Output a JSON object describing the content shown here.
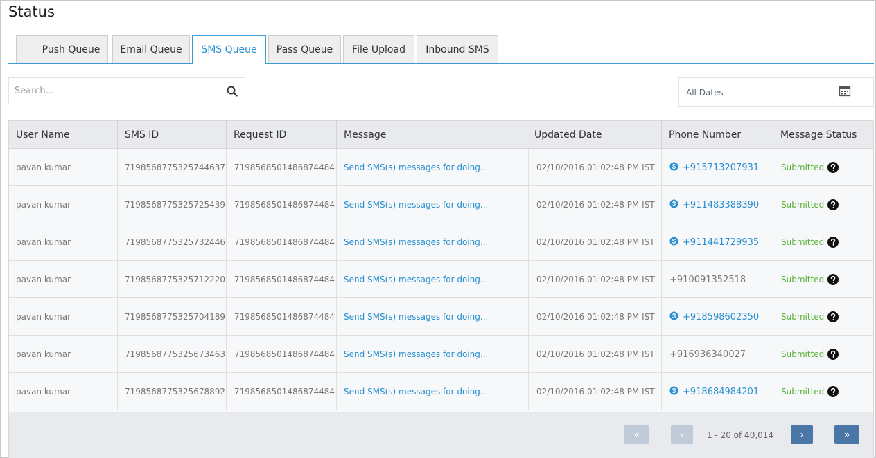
{
  "page": {
    "title": "Status"
  },
  "tabs": [
    {
      "label": "Push Queue",
      "active": false
    },
    {
      "label": "Email Queue",
      "active": false
    },
    {
      "label": "SMS Queue",
      "active": true
    },
    {
      "label": "Pass Queue",
      "active": false
    },
    {
      "label": "File Upload",
      "active": false
    },
    {
      "label": "Inbound SMS",
      "active": false
    }
  ],
  "search": {
    "placeholder": "Search...",
    "icon": "search-icon"
  },
  "date_filter": {
    "label": "All Dates",
    "icon": "calendar-icon"
  },
  "table": {
    "columns": [
      "User Name",
      "SMS ID",
      "Request ID",
      "Message",
      "Updated Date",
      "Phone Number",
      "Message Status"
    ],
    "rows": [
      {
        "user": "pavan kumar",
        "sms_id": "7198568775325744637",
        "request_id": "7198568501486874484",
        "message": "Send SMS(s) messages for doing...",
        "date": "02/10/2016 01:02:48 PM IST",
        "phone": "+915713207931",
        "phone_link": true,
        "status": "Submitted"
      },
      {
        "user": "pavan kumar",
        "sms_id": "7198568775325725439",
        "request_id": "7198568501486874484",
        "message": "Send SMS(s) messages for doing...",
        "date": "02/10/2016 01:02:48 PM IST",
        "phone": "+911483388390",
        "phone_link": true,
        "status": "Submitted"
      },
      {
        "user": "pavan kumar",
        "sms_id": "7198568775325732446",
        "request_id": "7198568501486874484",
        "message": "Send SMS(s) messages for doing...",
        "date": "02/10/2016 01:02:48 PM IST",
        "phone": "+911441729935",
        "phone_link": true,
        "status": "Submitted"
      },
      {
        "user": "pavan kumar",
        "sms_id": "7198568775325712220",
        "request_id": "7198568501486874484",
        "message": "Send SMS(s) messages for doing...",
        "date": "02/10/2016 01:02:48 PM IST",
        "phone": "+910091352518",
        "phone_link": false,
        "status": "Submitted"
      },
      {
        "user": "pavan kumar",
        "sms_id": "7198568775325704189",
        "request_id": "7198568501486874484",
        "message": "Send SMS(s) messages for doing...",
        "date": "02/10/2016 01:02:48 PM IST",
        "phone": "+918598602350",
        "phone_link": true,
        "status": "Submitted"
      },
      {
        "user": "pavan kumar",
        "sms_id": "7198568775325673463",
        "request_id": "7198568501486874484",
        "message": "Send SMS(s) messages for doing...",
        "date": "02/10/2016 01:02:48 PM IST",
        "phone": "+916936340027",
        "phone_link": false,
        "status": "Submitted"
      },
      {
        "user": "pavan kumar",
        "sms_id": "7198568775325678892",
        "request_id": "7198568501486874484",
        "message": "Send SMS(s) messages for doing...",
        "date": "02/10/2016 01:02:48 PM IST",
        "phone": "+918684984201",
        "phone_link": true,
        "status": "Submitted"
      }
    ]
  },
  "pagination": {
    "first": "«",
    "prev": "‹",
    "next": "›",
    "last": "»",
    "info": "1 - 20 of 40,014",
    "first_enabled": false,
    "prev_enabled": false,
    "next_enabled": true,
    "last_enabled": true
  },
  "colors": {
    "accent": "#2a8fd0",
    "status_submitted": "#5ab334",
    "pager_enabled": "#4a76a8",
    "pager_disabled": "#bfcbd8"
  }
}
